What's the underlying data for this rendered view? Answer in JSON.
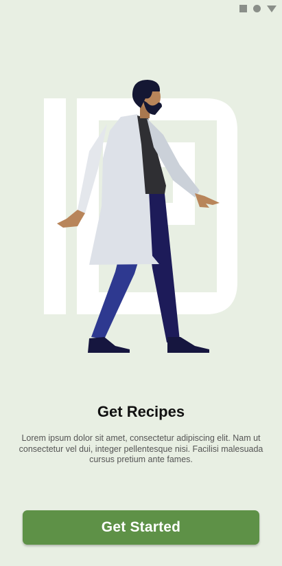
{
  "status_bar": {
    "icons": [
      "square-icon",
      "circle-icon",
      "triangle-icon"
    ]
  },
  "illustration": {
    "description_icon": "walking-chef-illustration"
  },
  "onboarding": {
    "title": "Get Recipes",
    "description": "Lorem ipsum dolor sit amet, consectetur adipiscing elit. Nam ut consectetur vel dui, integer pellentesque nisi. Facilisi malesuada cursus pretium ante fames.",
    "button_label": "Get Started"
  },
  "colors": {
    "background": "#e8efe3",
    "primary": "#5e9147",
    "title_text": "#111111",
    "body_text": "#555555"
  }
}
